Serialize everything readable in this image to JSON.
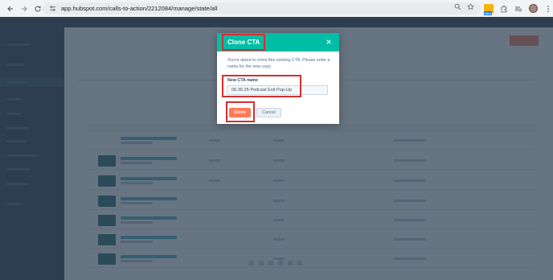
{
  "browser": {
    "url": "app.hubspot.com/calls-to-action/2212084/manage/state/all",
    "extension_badge": "New"
  },
  "modal": {
    "title": "Clone CTA",
    "description": "You're about to clone this existing CTA. Please enter a name for the new copy.",
    "field_label": "New CTA name",
    "field_value": "06.30.25 Podcast Exit Pop-Up",
    "clone_label": "Clone",
    "cancel_label": "Cancel"
  },
  "colors": {
    "header": "#00bda5",
    "primary_button": "#ff7a59",
    "highlight": "#d32f2f"
  }
}
